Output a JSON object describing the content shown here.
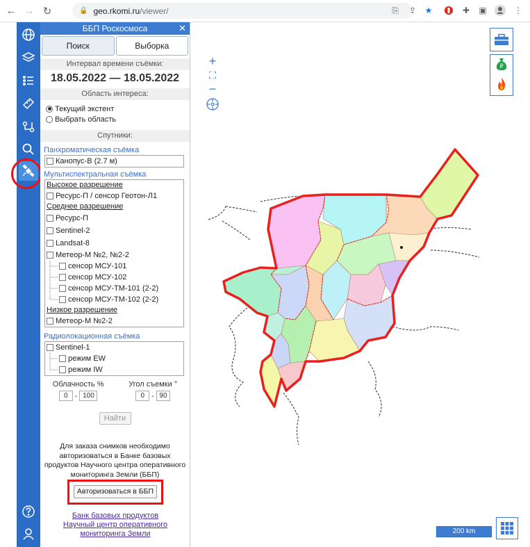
{
  "browser": {
    "url_host": "geo.rkomi.ru",
    "url_path": "/viewer/"
  },
  "panel": {
    "title": "ББП Роскосмоса",
    "tabs": [
      {
        "label": "Поиск"
      },
      {
        "label": "Выборка"
      }
    ],
    "interval_label": "Интервал времени съёмки:",
    "dates": "18.05.2022 — 18.05.2022",
    "area_label": "Область интереса:",
    "area_options": [
      {
        "label": "Текущий экстент",
        "checked": true
      },
      {
        "label": "Выбрать область",
        "checked": false
      }
    ],
    "satellites_label": "Спутники:",
    "pan": {
      "title": "Панхроматическая съёмка",
      "items": [
        "Канопус-В (2.7 м)"
      ]
    },
    "multi": {
      "title": "Мультиспектральная съёмка",
      "high": "Высокое разрешение",
      "high_items": [
        "Ресурс-П / сенсор Геотон-Л1"
      ],
      "mid": "Среднее разрешение",
      "mid_items": [
        "Ресурс-П",
        "Sentinel-2",
        "Landsat-8",
        "Метеор-М №2, №2-2"
      ],
      "meteor_sensors": [
        "сенсор МСУ-101",
        "сенсор МСУ-102",
        "сенсор МСУ-ТМ-101 (2-2)",
        "сенсор МСУ-ТМ-102 (2-2)"
      ],
      "low": "Низкое разрешение",
      "low_items": [
        "Метеор-М №2-2"
      ]
    },
    "radar": {
      "title": "Радиолокационная съёмка",
      "item": "Sentinel-1",
      "modes": [
        "режим EW",
        "режим IW"
      ]
    },
    "cloud_label": "Облачность %",
    "cloud_min": "0",
    "cloud_max": "100",
    "angle_label": "Угол съемки °",
    "angle_min": "0",
    "angle_max": "90",
    "find_label": "Найти",
    "note": "Для заказа снимков необходимо авторизоваться в Банке базовых продуктов Научного центра оперативного мониторинга Земли (ББП)",
    "auth_label": "Авторизоваться в ББП",
    "link1": "Банк базовых продуктов",
    "link2": "Научный центр оперативного мониторинга Земли"
  },
  "map": {
    "scale": "200 km"
  },
  "colors": {
    "accent": "#3d7cd1",
    "highlight": "#ee1111",
    "boundary": "#e8201e"
  }
}
